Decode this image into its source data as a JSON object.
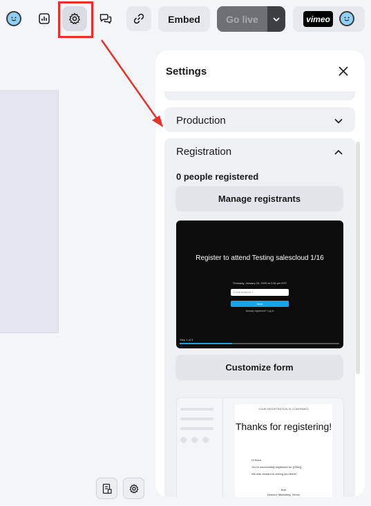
{
  "toolbar": {
    "embed_label": "Embed",
    "golive_label": "Go live",
    "brand_logo_text": "vimeo",
    "icons": [
      "avatar-icon",
      "analytics-icon",
      "gear-icon",
      "chat-bubbles-icon",
      "link-icon",
      "chevron-down-icon"
    ]
  },
  "settings": {
    "title": "Settings",
    "sections": {
      "production": {
        "label": "Production"
      },
      "registration": {
        "label": "Registration",
        "registered_count": "0 people registered",
        "manage_button": "Manage registrants",
        "customize_button": "Customize form"
      }
    },
    "form_preview": {
      "title": "Register to attend Testing salescloud 1/16",
      "date": "Thursday, January 16, 2025 at 2:00 pm EST",
      "email_placeholder": "Email address *",
      "submit": "Next",
      "note": "Already registered? Log in",
      "step": "Step 1 of 3",
      "progress": 0.33
    },
    "thanks_preview": {
      "kicker": "YOUR REGISTRATION IS CONFIRMED",
      "heading": "Thanks for registering!",
      "greeting": "Hi there,",
      "line1": "You're successfully registered for {{Title}}.",
      "line2": "We look forward to seeing you there!",
      "sign_name": "Bob",
      "sign_title": "Director, Marketing, Vimeo"
    }
  },
  "colors": {
    "accent": "#17a4ec",
    "annotation": "#e8302a",
    "golive_bg": "#6d7075"
  }
}
